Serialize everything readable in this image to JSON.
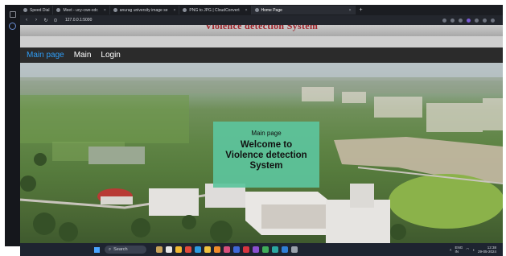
{
  "browser": {
    "tabs": [
      {
        "label": "Speed Dial",
        "active": false
      },
      {
        "label": "Meet - ucy-cwe-xdc",
        "active": false
      },
      {
        "label": "anurag university image se",
        "active": false
      },
      {
        "label": "PNG to JPG | CloudConvert",
        "active": false
      },
      {
        "label": "Home Page",
        "active": true
      }
    ],
    "new_tab_label": "+",
    "url": "127.0.0.1:5000"
  },
  "site": {
    "title": "Violence detection System"
  },
  "nav": {
    "items": [
      "Main page",
      "Main",
      "Login"
    ],
    "active_color": "#2f9df5"
  },
  "card": {
    "subtitle": "Main page",
    "heading_line1": "Welcome to",
    "heading_line2": "Violence detection",
    "heading_line3": "System"
  },
  "taskbar": {
    "search_label": "Search",
    "language": "ENG",
    "region": "IN",
    "time": "12:38",
    "date": "29-05-2024"
  }
}
